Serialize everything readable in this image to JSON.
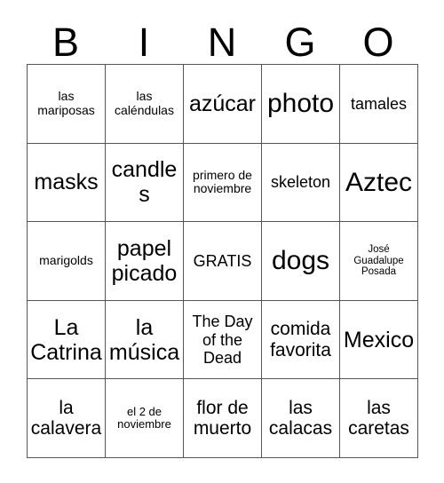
{
  "header": {
    "letters": [
      "B",
      "I",
      "N",
      "G",
      "O"
    ]
  },
  "grid": {
    "rows": [
      [
        {
          "text": "las mariposas",
          "size": "fs-sm"
        },
        {
          "text": "las caléndulas",
          "size": "fs-sm"
        },
        {
          "text": "azúcar",
          "size": "fs-xl"
        },
        {
          "text": "photo",
          "size": "fs-xxl"
        },
        {
          "text": "tamales",
          "size": "fs-md"
        }
      ],
      [
        {
          "text": "masks",
          "size": "fs-xl"
        },
        {
          "text": "candles",
          "size": "fs-xl"
        },
        {
          "text": "primero de noviembre",
          "size": "fs-sm"
        },
        {
          "text": "skeleton",
          "size": "fs-md"
        },
        {
          "text": "Aztec",
          "size": "fs-xxl"
        }
      ],
      [
        {
          "text": "marigolds",
          "size": "fs-sm"
        },
        {
          "text": "papel picado",
          "size": "fs-xl"
        },
        {
          "text": "GRATIS",
          "size": "fs-md"
        },
        {
          "text": "dogs",
          "size": "fs-xxl"
        },
        {
          "text": "José Guadalupe Posada",
          "size": "fs-xxs"
        }
      ],
      [
        {
          "text": "La Catrina",
          "size": "fs-xl"
        },
        {
          "text": "la música",
          "size": "fs-xl"
        },
        {
          "text": "The Day of the Dead",
          "size": "fs-md"
        },
        {
          "text": "comida favorita",
          "size": "fs-lg"
        },
        {
          "text": "Mexico",
          "size": "fs-xl"
        }
      ],
      [
        {
          "text": "la calavera",
          "size": "fs-lg"
        },
        {
          "text": "el 2 de noviembre",
          "size": "fs-xs"
        },
        {
          "text": "flor de muerto",
          "size": "fs-lg"
        },
        {
          "text": "las calacas",
          "size": "fs-lg"
        },
        {
          "text": "las caretas",
          "size": "fs-lg"
        }
      ]
    ]
  },
  "colors": {
    "background": "#ffffff",
    "text": "#000000",
    "grid_line": "#555555"
  }
}
